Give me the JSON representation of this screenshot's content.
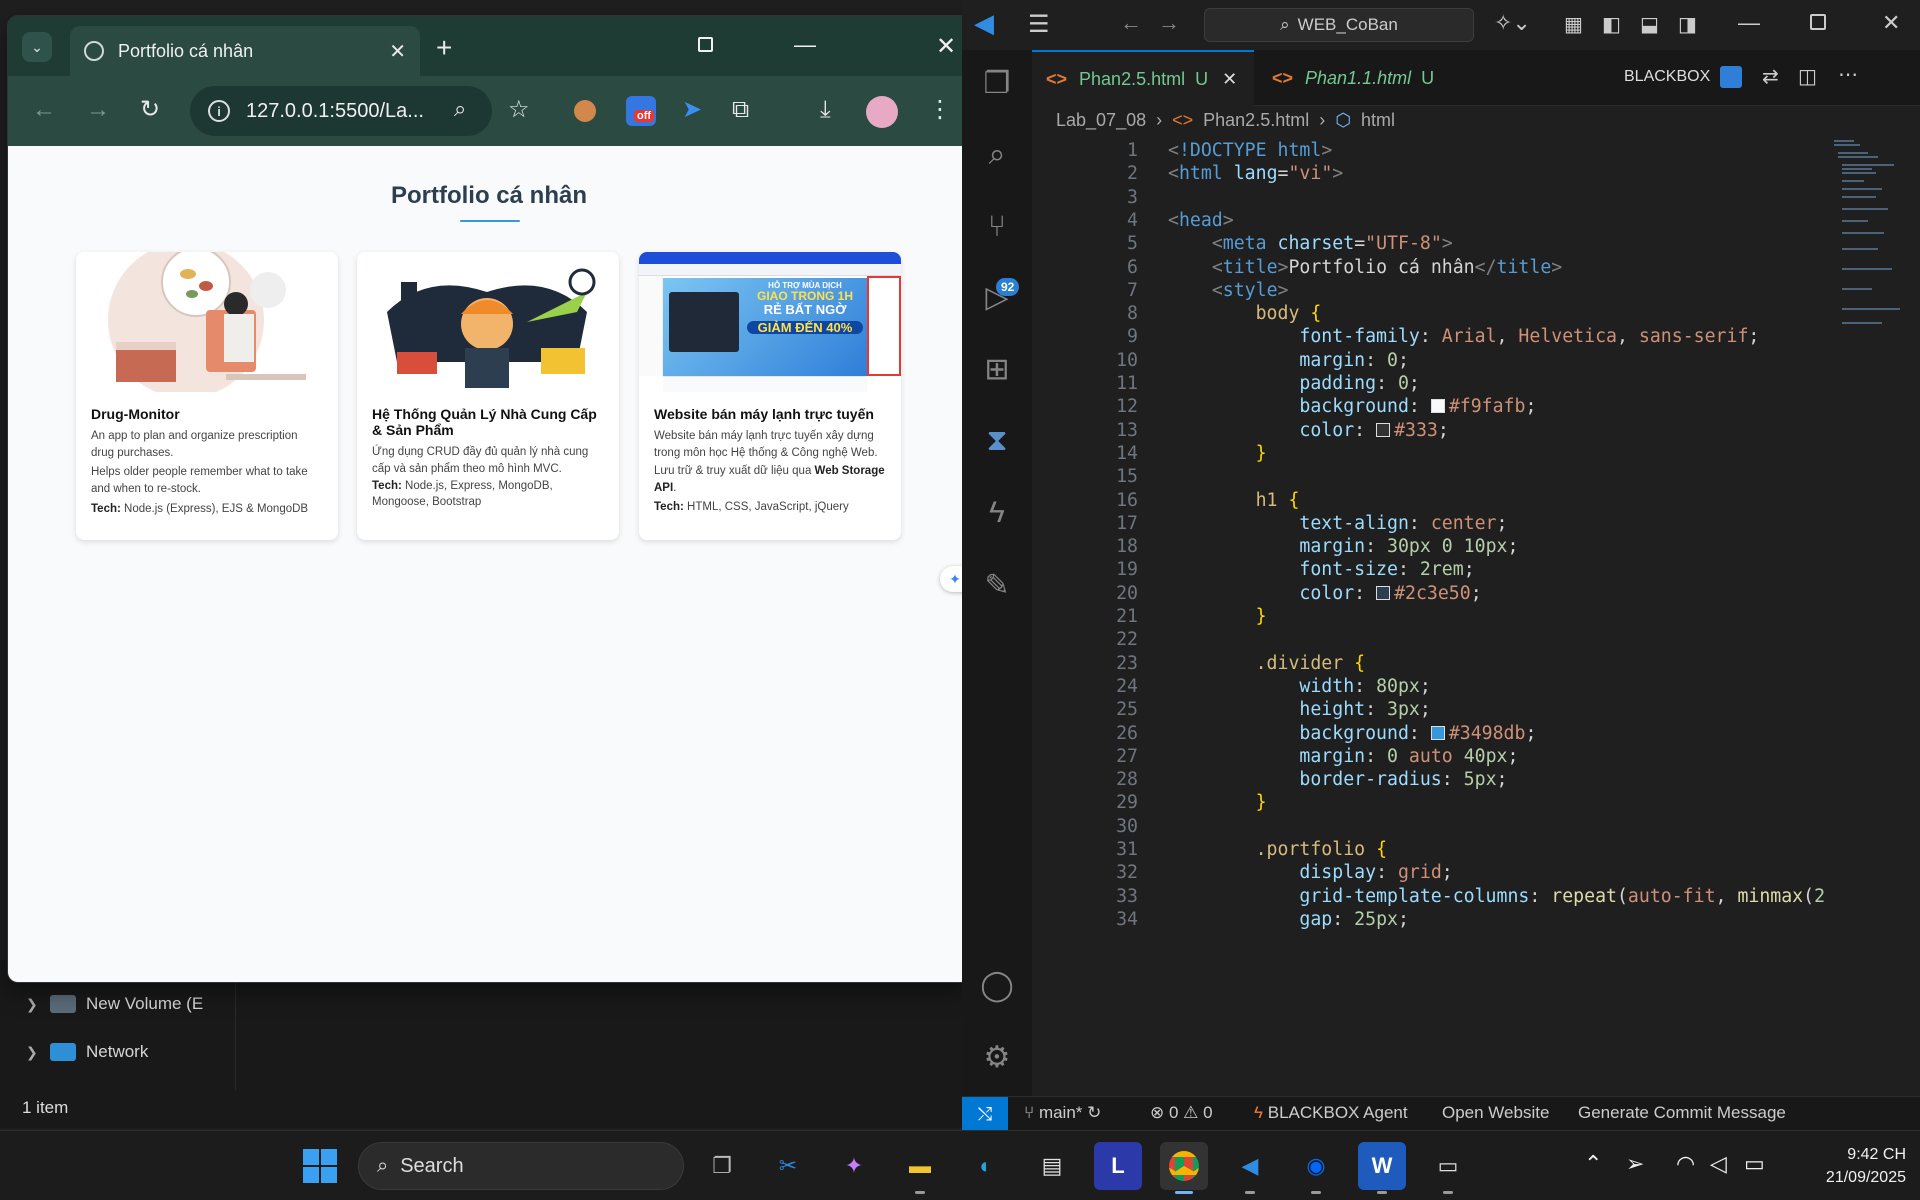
{
  "explorer": {
    "items": [
      "New Volume (E",
      "New Volume (E",
      "Network"
    ],
    "status": "1 item"
  },
  "browser": {
    "tab_title": "Portfolio cá nhân",
    "url": "127.0.0.1:5500/La...",
    "extension_badge": "off"
  },
  "page": {
    "title": "Portfolio cá nhân",
    "divider_color": "#3498db",
    "cards": [
      {
        "title": "Drug-Monitor",
        "lines": [
          "An app to plan and organize prescription drug purchases.",
          "Helps older people remember what to take and when to re-stock."
        ],
        "tech_label": "Tech:",
        "tech": "Node.js (Express), EJS & MongoDB"
      },
      {
        "title": "Hệ Thống Quản Lý Nhà Cung Cấp & Sản Phẩm",
        "lines": [
          "Ứng dụng CRUD đầy đủ quản lý nhà cung cấp và sản phẩm theo mô hình MVC."
        ],
        "tech_label": "Tech:",
        "tech": "Node.js, Express, MongoDB, Mongoose, Bootstrap"
      },
      {
        "title": "Website bán máy lạnh trực tuyến",
        "lines": [
          "Website bán máy lạnh trực tuyến xây dựng trong môn học Hệ thống & Công nghệ Web."
        ],
        "storage_prefix": "Lưu trữ & truy xuất dữ liệu qua ",
        "storage_bold": "Web Storage API",
        "storage_suffix": ".",
        "tech_label": "Tech:",
        "tech": "HTML, CSS, JavaScript, jQuery",
        "banner_line1": "HỖ TRỢ MÙA DỊCH",
        "banner_line2": "GIAO TRONG 1H",
        "banner_line3": "RẺ BẤT NGỜ",
        "banner_line4": "GIẢM ĐẾN 40%"
      }
    ]
  },
  "vscode": {
    "search": "WEB_CoBan",
    "tabs": [
      {
        "name": "Phan2.5.html",
        "status": "U",
        "active": true
      },
      {
        "name": "Phan1.1.html",
        "status": "U",
        "active": false
      }
    ],
    "blackbox_label": "BLACKBOX",
    "breadcrumb": [
      "Lab_07_08",
      "Phan2.5.html",
      "html"
    ],
    "source_control_badge": "92",
    "line_numbers": [
      "1",
      "2",
      "3",
      "4",
      "5",
      "6",
      "7",
      "8",
      "9",
      "10",
      "11",
      "12",
      "13",
      "14",
      "15",
      "16",
      "17",
      "18",
      "19",
      "20",
      "21",
      "22",
      "23",
      "24",
      "25",
      "26",
      "27",
      "28",
      "29",
      "30",
      "31",
      "32",
      "33",
      "34"
    ],
    "status": {
      "branch": "main*",
      "errors": "0",
      "warnings": "0",
      "agent": "BLACKBOX Agent",
      "open_website": "Open Website",
      "commit": "Generate Commit Message"
    }
  },
  "taskbar": {
    "search_placeholder": "Search",
    "time": "9:42 CH",
    "date": "21/09/2025"
  }
}
